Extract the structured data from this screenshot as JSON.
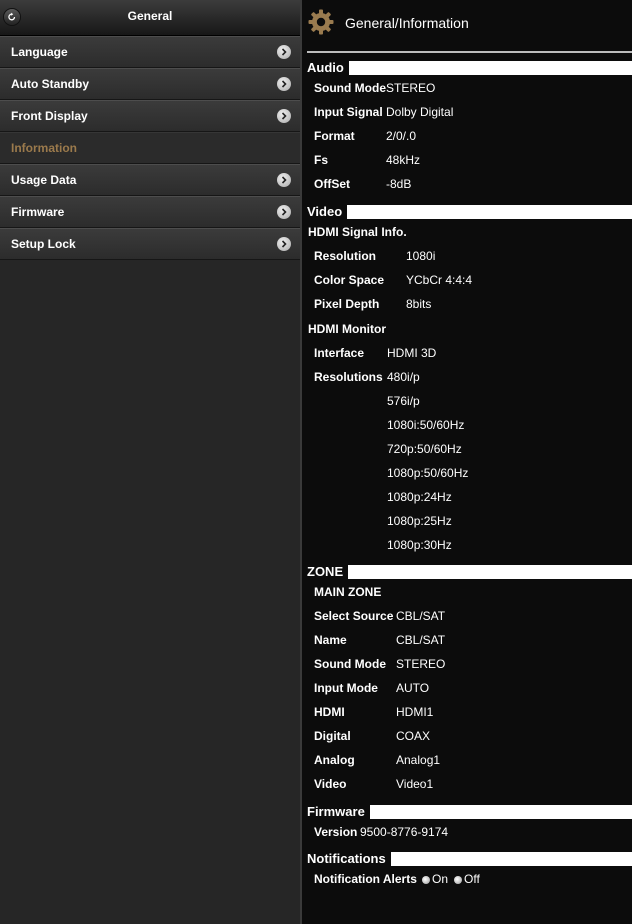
{
  "sidebar": {
    "title": "General",
    "items": [
      {
        "label": "Language"
      },
      {
        "label": "Auto Standby"
      },
      {
        "label": "Front Display"
      },
      {
        "label": "Information"
      },
      {
        "label": "Usage Data"
      },
      {
        "label": "Firmware"
      },
      {
        "label": "Setup Lock"
      }
    ]
  },
  "page": {
    "title": "General/Information"
  },
  "audio": {
    "heading": "Audio",
    "rows": [
      {
        "k": "Sound Mode",
        "v": "STEREO"
      },
      {
        "k": "Input Signal",
        "v": "Dolby Digital"
      },
      {
        "k": "Format",
        "v": "2/0/.0"
      },
      {
        "k": "Fs",
        "v": "48kHz"
      },
      {
        "k": "OffSet",
        "v": "-8dB"
      }
    ]
  },
  "video": {
    "heading": "Video",
    "hdmi_signal_heading": "HDMI Signal Info.",
    "signal_rows": [
      {
        "k": "Resolution",
        "v": "1080i"
      },
      {
        "k": "Color Space",
        "v": "YCbCr 4:4:4"
      },
      {
        "k": "Pixel Depth",
        "v": "8bits"
      }
    ],
    "hdmi_monitor_heading": "HDMI Monitor",
    "interface": {
      "k": "Interface",
      "v": "HDMI 3D"
    },
    "resolutions_label": "Resolutions",
    "resolutions": [
      "480i/p",
      "576i/p",
      "1080i:50/60Hz",
      "720p:50/60Hz",
      "1080p:50/60Hz",
      "1080p:24Hz",
      "1080p:25Hz",
      "1080p:30Hz"
    ]
  },
  "zone": {
    "heading": "ZONE",
    "main_zone": "MAIN ZONE",
    "rows": [
      {
        "k": "Select Source",
        "v": "CBL/SAT"
      },
      {
        "k": "Name",
        "v": "CBL/SAT"
      },
      {
        "k": "Sound Mode",
        "v": "STEREO"
      },
      {
        "k": "Input Mode",
        "v": "AUTO"
      },
      {
        "k": "HDMI",
        "v": "HDMI1"
      },
      {
        "k": "Digital",
        "v": "COAX"
      },
      {
        "k": "Analog",
        "v": "Analog1"
      },
      {
        "k": "Video",
        "v": "Video1"
      }
    ]
  },
  "firmware": {
    "heading": "Firmware",
    "k": "Version",
    "v": "9500-8776-9174"
  },
  "notifications": {
    "heading": "Notifications",
    "k": "Notification Alerts",
    "on": "On",
    "off": "Off",
    "selected": "On"
  },
  "icons": {
    "back": "back-arrow-icon",
    "chevron": "chevron-right-icon",
    "gear": "gear-icon"
  }
}
